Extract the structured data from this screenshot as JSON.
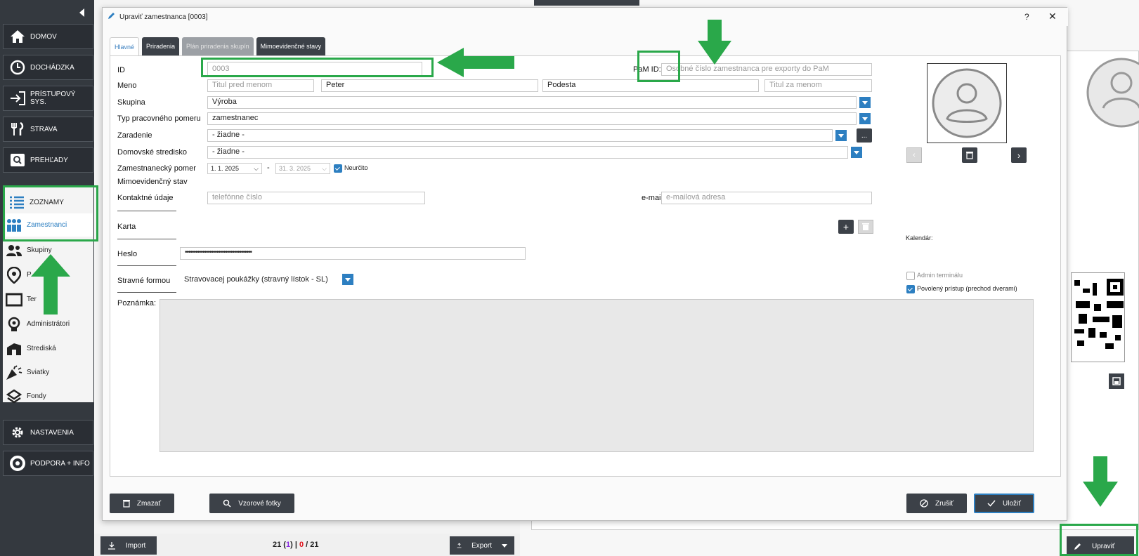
{
  "sidebar": {
    "main_items": [
      {
        "label": "DOMOV",
        "icon": "home-icon"
      },
      {
        "label": "DOCHÁDZKA",
        "icon": "clock-icon"
      },
      {
        "label": "PRÍSTUPOVÝ SYS.",
        "icon": "login-arrow-icon"
      },
      {
        "label": "STRAVA",
        "icon": "cutlery-icon"
      },
      {
        "label": "PREHĽADY",
        "icon": "search-icon"
      },
      {
        "label": "ZOZNAMY",
        "icon": "list-icon"
      }
    ],
    "sub_items": [
      {
        "label": "Zamestnanci",
        "icon": "employees-icon"
      },
      {
        "label": "Skupiny",
        "icon": "groups-icon"
      },
      {
        "label": "P",
        "icon": "location-pin-icon"
      },
      {
        "label": "Ter",
        "icon": "terminal-icon"
      },
      {
        "label": "Administrátori",
        "icon": "admin-icon"
      },
      {
        "label": "Strediská",
        "icon": "building-icon"
      },
      {
        "label": "Sviatky",
        "icon": "party-icon"
      },
      {
        "label": "Fondy",
        "icon": "layers-icon"
      }
    ],
    "bottom_items": [
      {
        "label": "NASTAVENIA",
        "icon": "gear-icon"
      },
      {
        "label": "PODPORA + INFO",
        "icon": "lifebuoy-icon"
      }
    ]
  },
  "dialog": {
    "title": "Upraviť zamestnanca [0003]",
    "help": "?",
    "close": "✕",
    "tabs": [
      "Hlavné",
      "Priradenia",
      "Plán priradenia skupín",
      "Mimoevidenčné stavy"
    ],
    "fields": {
      "id_label": "ID",
      "id_value": "0003",
      "pam_label": "PaM ID:",
      "pam_placeholder": "Osobné číslo zamestnanca pre exporty do PaM",
      "meno_label": "Meno",
      "titul_pred_placeholder": "Titul pred menom",
      "first_name": "Peter",
      "last_name": "Podesta",
      "titul_za_placeholder": "Titul za menom",
      "skupina_label": "Skupina",
      "skupina_value": "Výroba",
      "typ_label": "Typ pracovného pomeru",
      "typ_value": "zamestnanec",
      "zaradenie_label": "Zaradenie",
      "zaradenie_value": "- žiadne -",
      "more_btn": "...",
      "domovske_label": "Domovské stredisko",
      "domovske_value": "- žiadne -",
      "pomer_label": "Zamestnanecký pomer",
      "date_from": "1. 1. 2025",
      "date_sep": "-",
      "date_to": "31. 3. 2025",
      "neurcito": "Neurčito",
      "mimo_label": "Mimoevidenčný stav",
      "kontakt_label": "Kontaktné údaje",
      "phone_placeholder": "telefónne číslo",
      "email_label": "e-mail",
      "email_placeholder": "e-mailová adresa",
      "karta_label": "Karta",
      "add_card": "+",
      "heslo_label": "Heslo",
      "heslo_value": "••••••••••••••••••••••••••••••••••••••",
      "stravne_label": "Stravné formou",
      "stravne_value": "Stravovacej poukážky (stravný lístok - SL)",
      "poznamka_label": "Poznámka:",
      "kalendar_label": "Kalendár:",
      "admin_terminal": "Admin terminálu",
      "povoleny_pristup": "Povolený prístup (prechod dverami)"
    },
    "buttons": {
      "delete": "Zmazať",
      "sample_photos": "Vzorové fotky",
      "cancel": "Zrušiť",
      "save": "Uložiť"
    }
  },
  "bottom": {
    "import": "Import",
    "count_total": "21",
    "count_sel": "1",
    "count_err": "0",
    "count_of": "21",
    "export": "Export",
    "upravit": "Upraviť"
  },
  "colors": {
    "sidebar_bg": "#34393f",
    "accent_blue": "#2d7fc1",
    "highlight_green": "#2aa84a",
    "dark_button": "#3c4148"
  }
}
